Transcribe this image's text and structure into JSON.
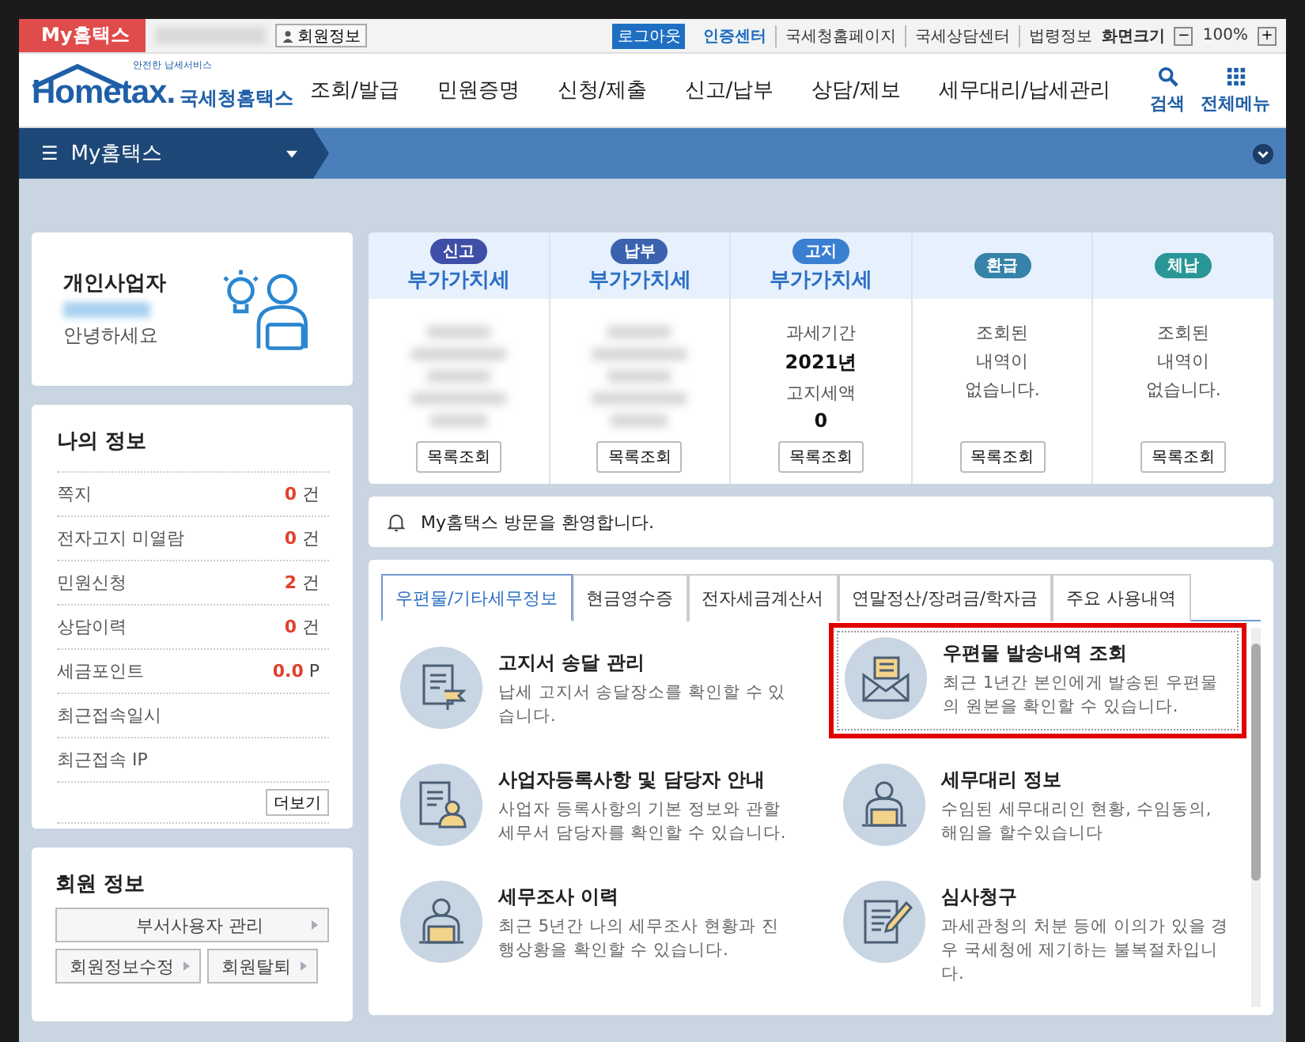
{
  "top_bar": {
    "site_tab": "My홈택스",
    "member_button": "회원정보",
    "logout_button": "로그아웃",
    "links": [
      {
        "label": "인증센터",
        "emphasis": true
      },
      {
        "label": "국세청홈페이지",
        "emphasis": false
      },
      {
        "label": "국세상담센터",
        "emphasis": false
      },
      {
        "label": "법령정보",
        "emphasis": false
      }
    ],
    "zoom_label": "화면크기",
    "zoom_minus": "−",
    "zoom_value": "100%",
    "zoom_plus": "+"
  },
  "header": {
    "logo": {
      "tagline": "안전한 납세서비스",
      "wordmark": "Hometax.",
      "name": "국세청홈택스"
    },
    "nav": [
      "조회/발급",
      "민원증명",
      "신청/제출",
      "신고/납부",
      "상담/제보",
      "세무대리/납세관리"
    ],
    "search_label": "검색",
    "menu_label": "전체메뉴"
  },
  "section_bar": {
    "menu_glyph": "☰",
    "title": "My홈택스"
  },
  "profile": {
    "type": "개인사업자",
    "greeting": "안녕하세요"
  },
  "my_info": {
    "title": "나의 정보",
    "rows": [
      {
        "label": "쪽지",
        "value": "0",
        "unit": "건"
      },
      {
        "label": "전자고지 미열람",
        "value": "0",
        "unit": "건"
      },
      {
        "label": "민원신청",
        "value": "2",
        "unit": "건"
      },
      {
        "label": "상담이력",
        "value": "0",
        "unit": "건"
      },
      {
        "label": "세금포인트",
        "value": "0.0",
        "unit": "P"
      },
      {
        "label": "최근접속일시"
      },
      {
        "label": "최근접속 IP"
      }
    ],
    "more_button": "더보기"
  },
  "member_info": {
    "title": "회원 정보",
    "buttons": [
      "부서사용자 관리",
      "회원정보수정",
      "회원탈퇴"
    ]
  },
  "summary": [
    {
      "badge": "신고",
      "color": "#3f4fa8",
      "title": "부가가치세",
      "kind": "blurred",
      "button": "목록조회"
    },
    {
      "badge": "납부",
      "color": "#3b62ae",
      "title": "부가가치세",
      "kind": "blurred",
      "button": "목록조회"
    },
    {
      "badge": "고지",
      "color": "#3a7fd2",
      "title": "부가가치세",
      "kind": "info",
      "lines": [
        {
          "text": "과세기간",
          "bold": false
        },
        {
          "text": "2021년",
          "bold": true
        },
        {
          "text": "고지세액",
          "bold": false
        },
        {
          "text": "0",
          "bold": true
        }
      ],
      "button": "목록조회"
    },
    {
      "badge": "환급",
      "color": "#3682a8",
      "kind": "info",
      "lines": [
        {
          "text": "조회된",
          "bold": false
        },
        {
          "text": "내역이",
          "bold": false
        },
        {
          "text": "없습니다.",
          "bold": false
        }
      ],
      "button": "목록조회"
    },
    {
      "badge": "체납",
      "color": "#2a9696",
      "kind": "info",
      "lines": [
        {
          "text": "조회된",
          "bold": false
        },
        {
          "text": "내역이",
          "bold": false
        },
        {
          "text": "없습니다.",
          "bold": false
        }
      ],
      "button": "목록조회"
    }
  ],
  "notice": "My홈택스 방문을 환영합니다.",
  "tabs": [
    {
      "label": "우편물/기타세무정보",
      "selected": true
    },
    {
      "label": "현금영수증",
      "selected": false
    },
    {
      "label": "전자세금계산서",
      "selected": false
    },
    {
      "label": "연말정산/장려금/학자금",
      "selected": false
    },
    {
      "label": "주요 사용내역",
      "selected": false
    }
  ],
  "services": [
    {
      "kind": "notice-doc",
      "title": "고지서 송달 관리",
      "desc": "납세 고지서 송달장소를 확인할 수 있습니다.",
      "highlighted": false
    },
    {
      "kind": "envelope",
      "title": "우편물 발송내역 조회",
      "desc": "최근 1년간 본인에게 발송된 우편물의 원본을 확인할 수 있습니다.",
      "highlighted": true
    },
    {
      "kind": "doc-person",
      "title": "사업자등록사항 및 담당자 안내",
      "desc": "사업자 등록사항의 기본 정보와 관할 세무서 담당자를 확인할 수 있습니다.",
      "highlighted": false
    },
    {
      "kind": "person-laptop",
      "title": "세무대리 정보",
      "desc": "수임된 세무대리인 현황, 수임동의, 해임을 할수있습니다",
      "highlighted": false
    },
    {
      "kind": "person-laptop",
      "title": "세무조사 이력",
      "desc": "최근 5년간 나의 세무조사 현황과 진행상황을 확인할 수 있습니다.",
      "highlighted": false
    },
    {
      "kind": "doc-pen",
      "title": "심사청구",
      "desc": "과세관청의 처분 등에 이의가 있을 경우 국세청에 제기하는 불복절차입니다.",
      "highlighted": false
    }
  ]
}
